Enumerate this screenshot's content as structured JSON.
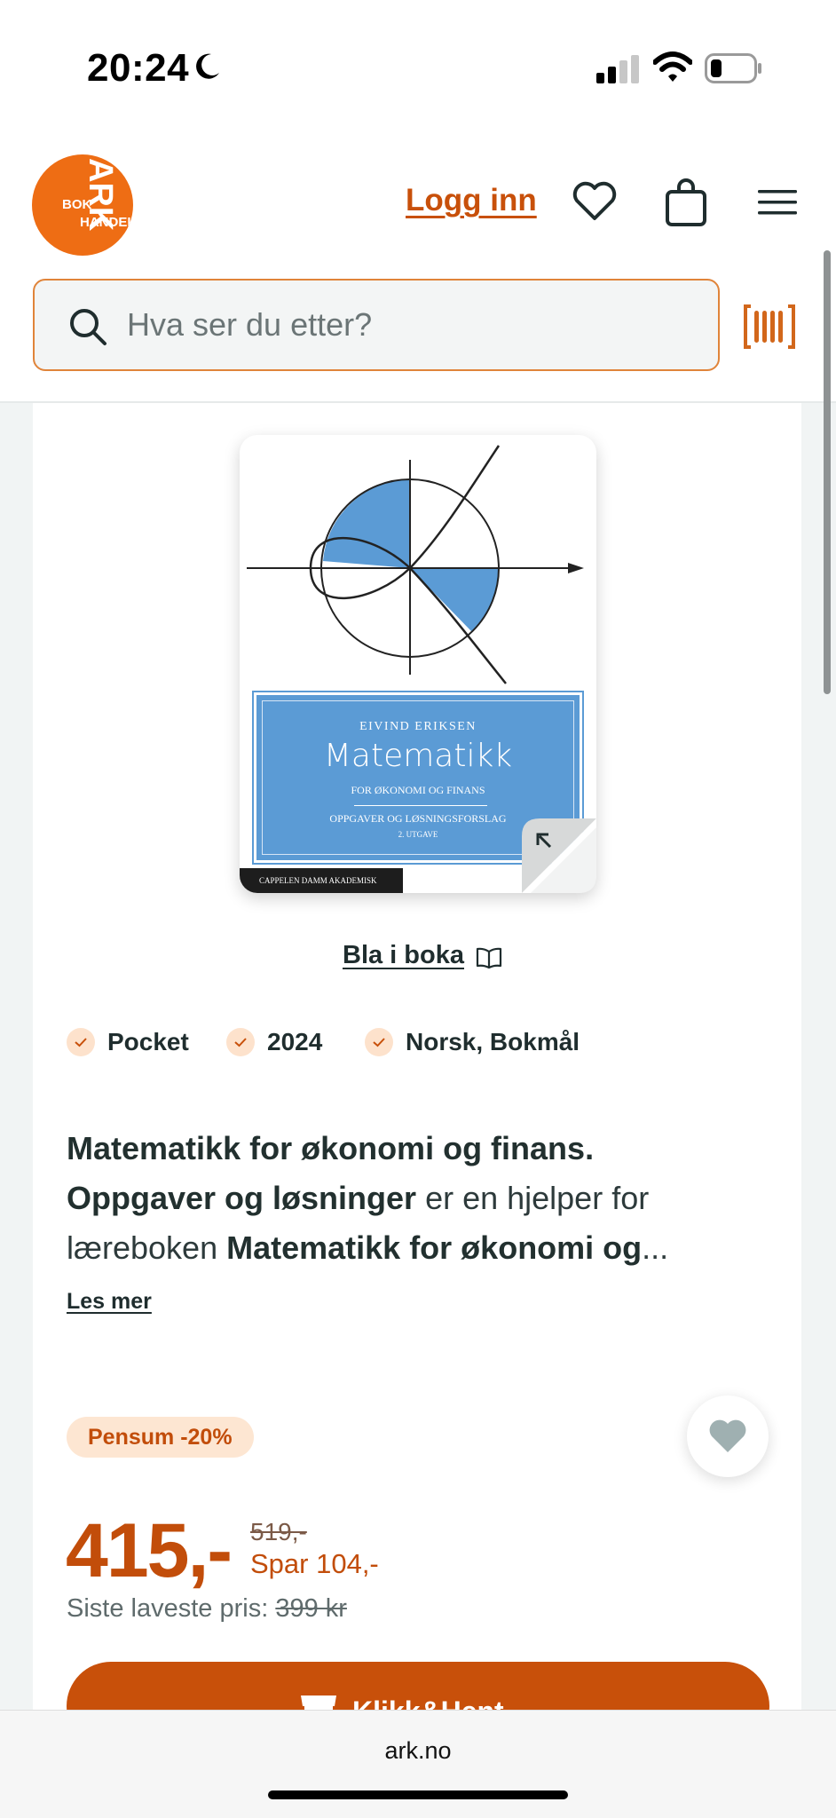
{
  "status": {
    "time": "20:24"
  },
  "header": {
    "logo": {
      "ark": "ARK",
      "bok": "BOK",
      "handel": "HANDEL"
    },
    "login_label": "Logg inn",
    "search_placeholder": "Hva ser du etter?"
  },
  "book": {
    "cover": {
      "author": "EIVIND ERIKSEN",
      "title": "Matematikk",
      "subtitle": "FOR ØKONOMI OG FINANS",
      "series": "OPPGAVER OG LØSNINGSFORSLAG",
      "edition": "2. UTGAVE",
      "publisher": "CAPPELEN DAMM AKADEMISK"
    },
    "browse_label": "Bla i boka",
    "tags": [
      "Pocket",
      "2024",
      "Norsk, Bokmål"
    ],
    "description": {
      "line1_bold": "Matematikk for økonomi og finans.",
      "line2_bold": "Oppgaver og løsninger",
      "line2_rest": " er en hjelper for",
      "line3_start": "læreboken ",
      "line3_bold": "Matematikk for økonomi og",
      "ellipsis": "..."
    },
    "read_more": "Les mer",
    "badge": "Pensum -20%",
    "price": "415,-",
    "old_price": "519,-",
    "save": "Spar 104,-",
    "lowest_label": "Siste laveste pris: ",
    "lowest_value": "399 kr",
    "cta_label": "Klikk&Hent"
  },
  "browser": {
    "url": "ark.no"
  },
  "colors": {
    "brand_orange": "#ee6d14",
    "accent": "#c8500a",
    "badge_bg": "#fde6d2",
    "cover_blue": "#5b9bd5"
  }
}
